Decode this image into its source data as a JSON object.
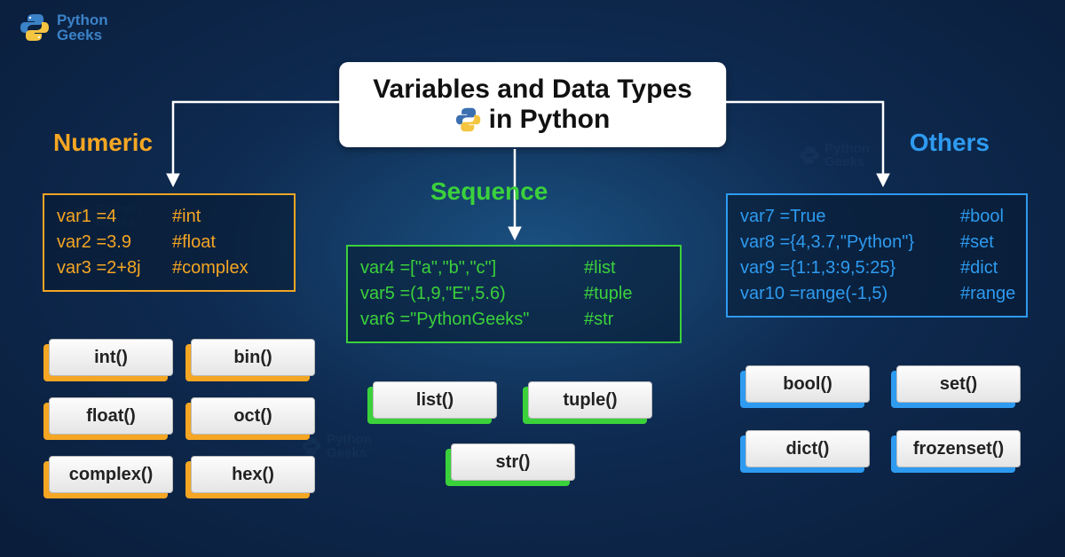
{
  "logo": {
    "line1": "Python",
    "line2": "Geeks"
  },
  "title": {
    "line1": "Variables and Data Types",
    "line2": "in Python"
  },
  "categories": {
    "numeric": {
      "label": "Numeric",
      "code": [
        {
          "lhs": "var1 =4",
          "comment": "#int"
        },
        {
          "lhs": "var2 =3.9",
          "comment": "#float"
        },
        {
          "lhs": "var3 =2+8j",
          "comment": "#complex"
        }
      ],
      "functions": [
        "int()",
        "bin()",
        "float()",
        "oct()",
        "complex()",
        "hex()"
      ]
    },
    "sequence": {
      "label": "Sequence",
      "code": [
        {
          "lhs": "var4 =[\"a\",\"b\",\"c\"]",
          "comment": "#list"
        },
        {
          "lhs": "var5 =(1,9,\"E\",5.6)",
          "comment": "#tuple"
        },
        {
          "lhs": "var6 =\"PythonGeeks\"",
          "comment": "#str"
        }
      ],
      "functions": [
        "list()",
        "tuple()",
        "str()"
      ]
    },
    "others": {
      "label": "Others",
      "code": [
        {
          "lhs": "var7 =True",
          "comment": "#bool"
        },
        {
          "lhs": "var8 ={4,3.7,\"Python\"}",
          "comment": "#set"
        },
        {
          "lhs": "var9 ={1:1,3:9,5:25}",
          "comment": "#dict"
        },
        {
          "lhs": "var10 =range(-1,5)",
          "comment": "#range"
        }
      ],
      "functions": [
        "bool()",
        "set()",
        "dict()",
        "frozenset()"
      ]
    }
  }
}
